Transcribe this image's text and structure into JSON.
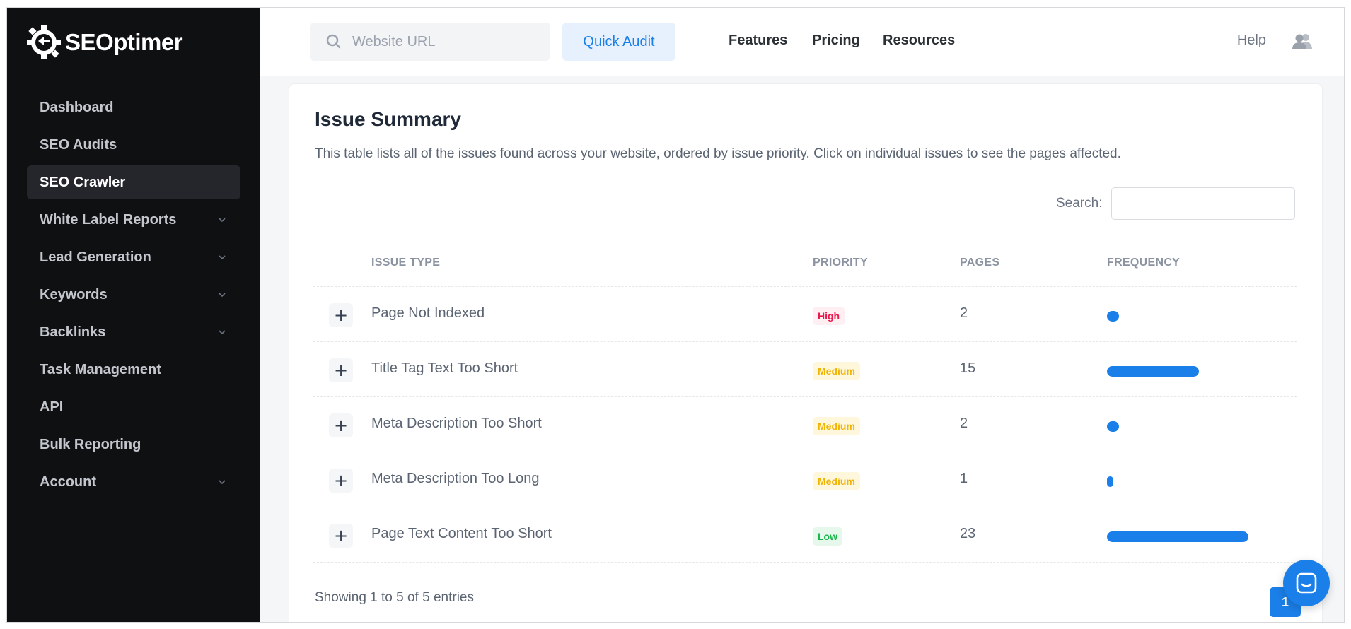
{
  "brand": {
    "name": "SEOptimer"
  },
  "sidebar": {
    "items": [
      {
        "label": "Dashboard",
        "has_submenu": false
      },
      {
        "label": "SEO Audits",
        "has_submenu": false
      },
      {
        "label": "SEO Crawler",
        "has_submenu": false,
        "active": true
      },
      {
        "label": "White Label Reports",
        "has_submenu": true
      },
      {
        "label": "Lead Generation",
        "has_submenu": true
      },
      {
        "label": "Keywords",
        "has_submenu": true
      },
      {
        "label": "Backlinks",
        "has_submenu": true
      },
      {
        "label": "Task Management",
        "has_submenu": false
      },
      {
        "label": "API",
        "has_submenu": false
      },
      {
        "label": "Bulk Reporting",
        "has_submenu": false
      },
      {
        "label": "Account",
        "has_submenu": true
      }
    ]
  },
  "topbar": {
    "url_placeholder": "Website URL",
    "quick_audit_label": "Quick Audit",
    "links": [
      "Features",
      "Pricing",
      "Resources"
    ],
    "help_label": "Help"
  },
  "issue_summary": {
    "title": "Issue Summary",
    "description": "This table lists all of the issues found across your website, ordered by issue priority. Click on individual issues to see the pages affected.",
    "search_label": "Search:",
    "columns": [
      "ISSUE TYPE",
      "PRIORITY",
      "PAGES",
      "FREQUENCY"
    ],
    "rows": [
      {
        "issue": "Page Not Indexed",
        "priority": "High",
        "pages": "2",
        "frequency_pct": 8.7
      },
      {
        "issue": "Title Tag Text Too Short",
        "priority": "Medium",
        "pages": "15",
        "frequency_pct": 65.2
      },
      {
        "issue": "Meta Description Too Short",
        "priority": "Medium",
        "pages": "2",
        "frequency_pct": 8.7
      },
      {
        "issue": "Meta Description Too Long",
        "priority": "Medium",
        "pages": "1",
        "frequency_pct": 4.3
      },
      {
        "issue": "Page Text Content Too Short",
        "priority": "Low",
        "pages": "23",
        "frequency_pct": 100
      }
    ],
    "footer_text": "Showing 1 to 5 of 5 entries",
    "current_page": "1"
  },
  "colors": {
    "accent": "#1a7fe8",
    "sidebar_bg": "#0f1012",
    "high": "#e8174c",
    "medium": "#efb404",
    "low": "#19b34b"
  }
}
